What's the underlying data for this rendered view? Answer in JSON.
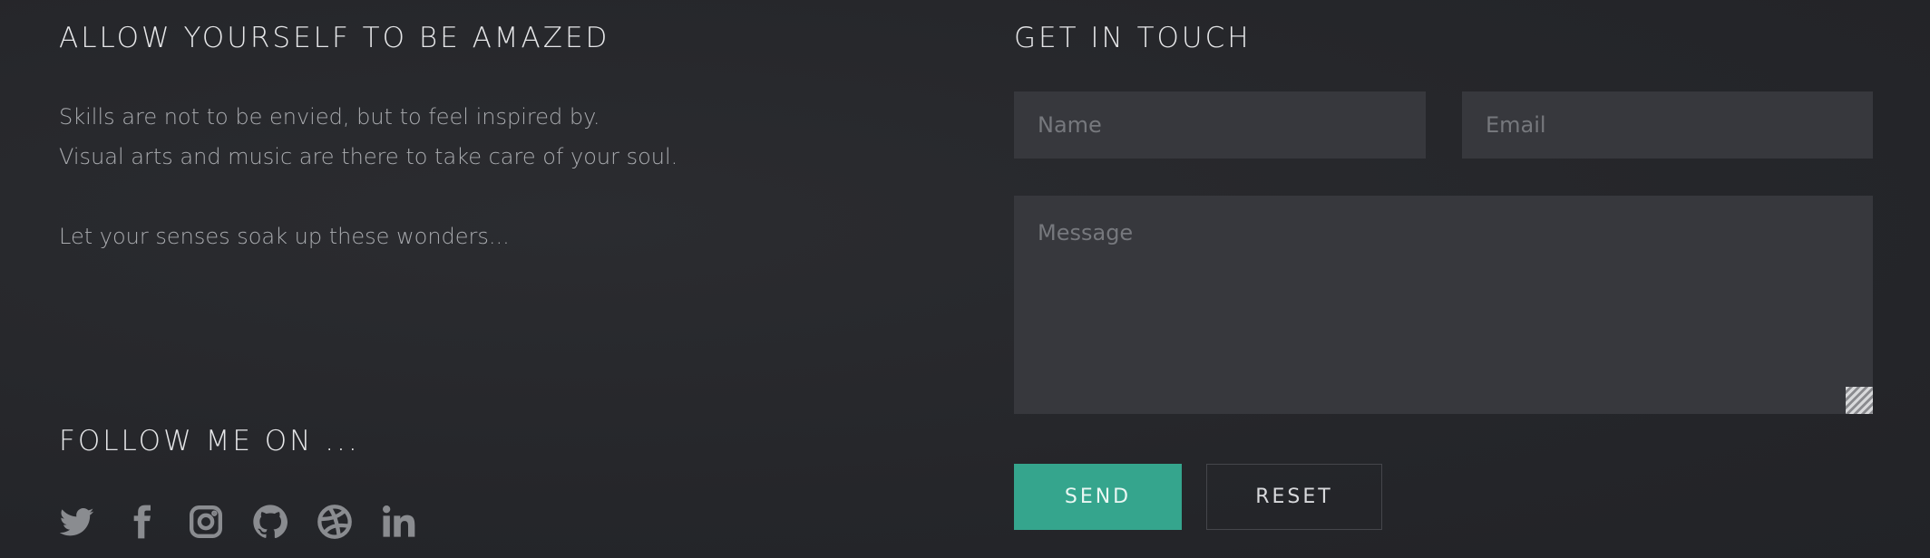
{
  "about": {
    "title": "ALLOW YOURSELF TO BE AMAZED",
    "line1": "Skills are not to be envied, but to feel inspired by.",
    "line2": "Visual arts and music are there to take care of your soul.",
    "line3": "Let your senses soak up these wonders..."
  },
  "follow": {
    "title": "FOLLOW ME ON ...",
    "icons": [
      "twitter-icon",
      "facebook-icon",
      "instagram-icon",
      "github-icon",
      "dribbble-icon",
      "linkedin-icon"
    ]
  },
  "contact": {
    "title": "GET IN TOUCH",
    "name_placeholder": "Name",
    "email_placeholder": "Email",
    "message_placeholder": "Message",
    "send_label": "SEND",
    "reset_label": "RESET"
  },
  "colors": {
    "background": "#26272b",
    "field": "#37383d",
    "accent": "#35a58d",
    "icon": "#8a8c90"
  }
}
